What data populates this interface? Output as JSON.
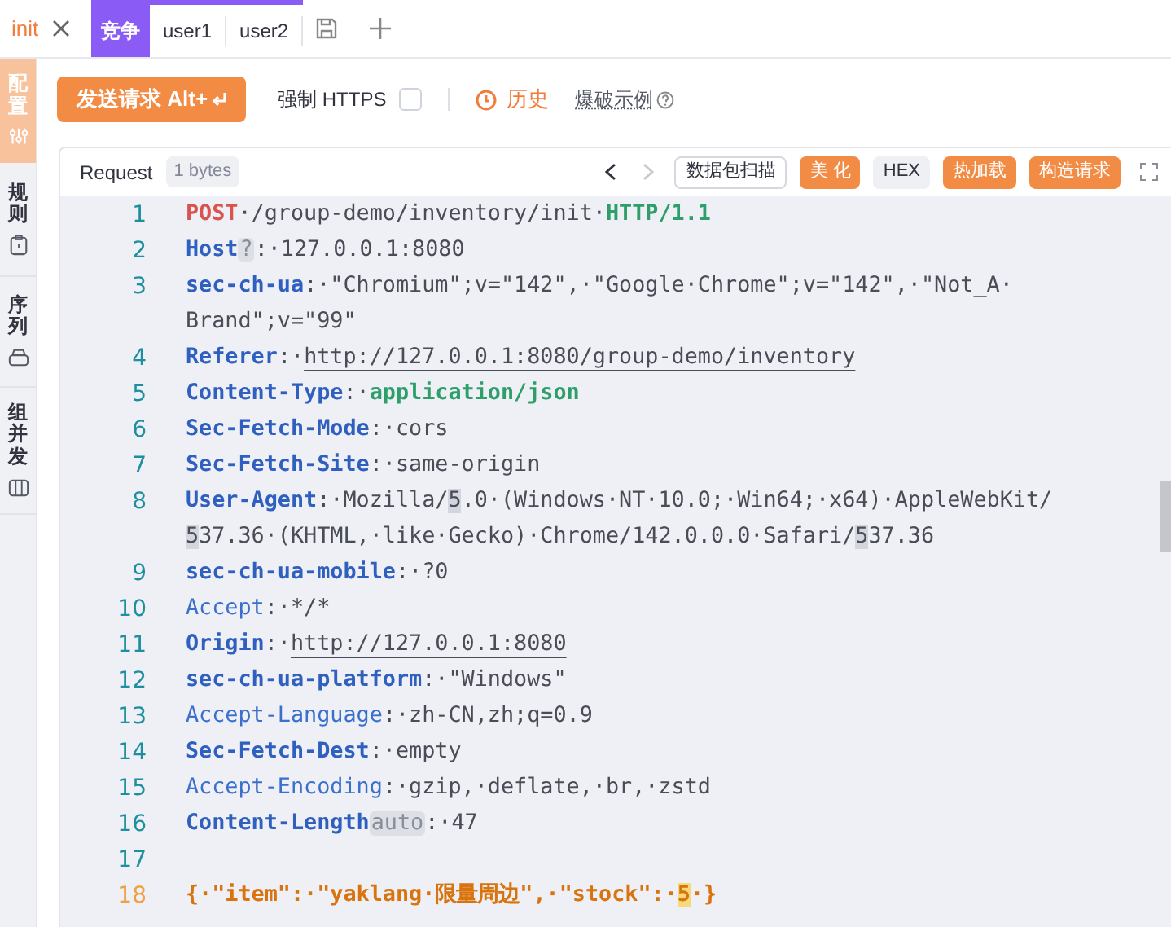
{
  "page_tab": {
    "label": "init"
  },
  "sub_tabs": [
    {
      "label": "竞争",
      "selected": true
    },
    {
      "label": "user1",
      "selected": false
    },
    {
      "label": "user2",
      "selected": false
    }
  ],
  "side_tabs": [
    {
      "label": "配置",
      "selected": true
    },
    {
      "label": "规则",
      "selected": false
    },
    {
      "label": "序列",
      "selected": false
    },
    {
      "label": "组并发",
      "selected": false
    }
  ],
  "toolbar": {
    "send_button": "发送请求 Alt+",
    "force_https": {
      "label": "强制 HTTPS",
      "checked": false
    },
    "history": "历史",
    "example_link": "爆破示例"
  },
  "request": {
    "title": "Request",
    "size": "1 bytes",
    "back_disabled": false,
    "forward_disabled": true,
    "buttons": [
      {
        "label": "数据包扫描",
        "kind": "outline"
      },
      {
        "label": "美 化",
        "kind": "primary"
      },
      {
        "label": "HEX",
        "kind": "gray"
      },
      {
        "label": "热加载",
        "kind": "primary"
      },
      {
        "label": "构造请求",
        "kind": "primary"
      }
    ],
    "lines": [
      {
        "number": "1",
        "current": false,
        "tokens": [
          {
            "kind": "method",
            "text": "POST"
          },
          {
            "kind": "plain",
            "text": "·/group-demo/inventory/init·"
          },
          {
            "kind": "green",
            "text": "HTTP/1.1"
          }
        ]
      },
      {
        "number": "2",
        "current": false,
        "tokens": [
          {
            "kind": "key",
            "text": "Host"
          },
          {
            "kind": "tag",
            "text": "?"
          },
          {
            "kind": "plain",
            "text": ":·127.0.0.1:8080"
          }
        ]
      },
      {
        "number": "3",
        "current": false,
        "tokens": [
          {
            "kind": "key",
            "text": "sec-ch-ua"
          },
          {
            "kind": "plain",
            "text": ":·\"Chromium\";v=\"142\",·\"Google·Chrome\";v=\"142\",·\"Not_A·"
          }
        ]
      },
      {
        "tokens": [
          {
            "kind": "plain",
            "text": "Brand\";v=\"99\""
          }
        ]
      },
      {
        "number": "4",
        "current": false,
        "tokens": [
          {
            "kind": "key",
            "text": "Referer"
          },
          {
            "kind": "plain",
            "text": ":·"
          },
          {
            "kind": "url",
            "text": "http://127.0.0.1:8080/group-demo/inventory"
          }
        ]
      },
      {
        "number": "5",
        "current": false,
        "tokens": [
          {
            "kind": "key",
            "text": "Content-Type"
          },
          {
            "kind": "plain",
            "text": ":·"
          },
          {
            "kind": "green",
            "text": "application/json"
          }
        ]
      },
      {
        "number": "6",
        "current": false,
        "tokens": [
          {
            "kind": "key",
            "text": "Sec-Fetch-Mode"
          },
          {
            "kind": "plain",
            "text": ":·cors"
          }
        ]
      },
      {
        "number": "7",
        "current": false,
        "tokens": [
          {
            "kind": "key",
            "text": "Sec-Fetch-Site"
          },
          {
            "kind": "plain",
            "text": ":·same-origin"
          }
        ]
      },
      {
        "number": "8",
        "current": false,
        "tokens": [
          {
            "kind": "key",
            "text": "User-Agent"
          },
          {
            "kind": "plain",
            "text": ":·Mozilla/"
          },
          {
            "kind": "mark",
            "text": "5"
          },
          {
            "kind": "plain",
            "text": ".0·(Windows·NT·10.0;·Win64;·x64)·AppleWebKit/"
          }
        ]
      },
      {
        "tokens": [
          {
            "kind": "mark",
            "text": "5"
          },
          {
            "kind": "plain",
            "text": "37.36·(KHTML,·like·Gecko)·Chrome/142.0.0.0·Safari/"
          },
          {
            "kind": "mark",
            "text": "5"
          },
          {
            "kind": "plain",
            "text": "37.36"
          }
        ]
      },
      {
        "number": "9",
        "current": false,
        "tokens": [
          {
            "kind": "key",
            "text": "sec-ch-ua-mobile"
          },
          {
            "kind": "plain",
            "text": ":·?0"
          }
        ]
      },
      {
        "number": "10",
        "current": false,
        "tokens": [
          {
            "kind": "key_light",
            "text": "Accept"
          },
          {
            "kind": "plain",
            "text": ":·*/*"
          }
        ]
      },
      {
        "number": "11",
        "current": false,
        "tokens": [
          {
            "kind": "key",
            "text": "Origin"
          },
          {
            "kind": "plain",
            "text": ":·"
          },
          {
            "kind": "url",
            "text": "http://127.0.0.1:8080"
          }
        ]
      },
      {
        "number": "12",
        "current": false,
        "tokens": [
          {
            "kind": "key",
            "text": "sec-ch-ua-platform"
          },
          {
            "kind": "plain",
            "text": ":·\"Windows\""
          }
        ]
      },
      {
        "number": "13",
        "current": false,
        "tokens": [
          {
            "kind": "key_light",
            "text": "Accept-Language"
          },
          {
            "kind": "plain",
            "text": ":·zh-CN,zh;q=0.9"
          }
        ]
      },
      {
        "number": "14",
        "current": false,
        "tokens": [
          {
            "kind": "key",
            "text": "Sec-Fetch-Dest"
          },
          {
            "kind": "plain",
            "text": ":·empty"
          }
        ]
      },
      {
        "number": "15",
        "current": false,
        "tokens": [
          {
            "kind": "key_light",
            "text": "Accept-Encoding"
          },
          {
            "kind": "plain",
            "text": ":·gzip,·deflate,·br,·zstd"
          }
        ]
      },
      {
        "number": "16",
        "current": false,
        "tokens": [
          {
            "kind": "key",
            "text": "Content-Length"
          },
          {
            "kind": "tag",
            "text": "auto"
          },
          {
            "kind": "plain",
            "text": ":·47"
          }
        ]
      },
      {
        "number": "17",
        "current": false
      },
      {
        "number": "18",
        "current": true,
        "tokens": [
          {
            "kind": "json",
            "text": "{·\"item\":·\"yaklang·限量周边\",·\"stock\":·"
          },
          {
            "kind": "json_mark",
            "text": "5"
          },
          {
            "kind": "json",
            "text": "·}"
          }
        ]
      }
    ]
  }
}
